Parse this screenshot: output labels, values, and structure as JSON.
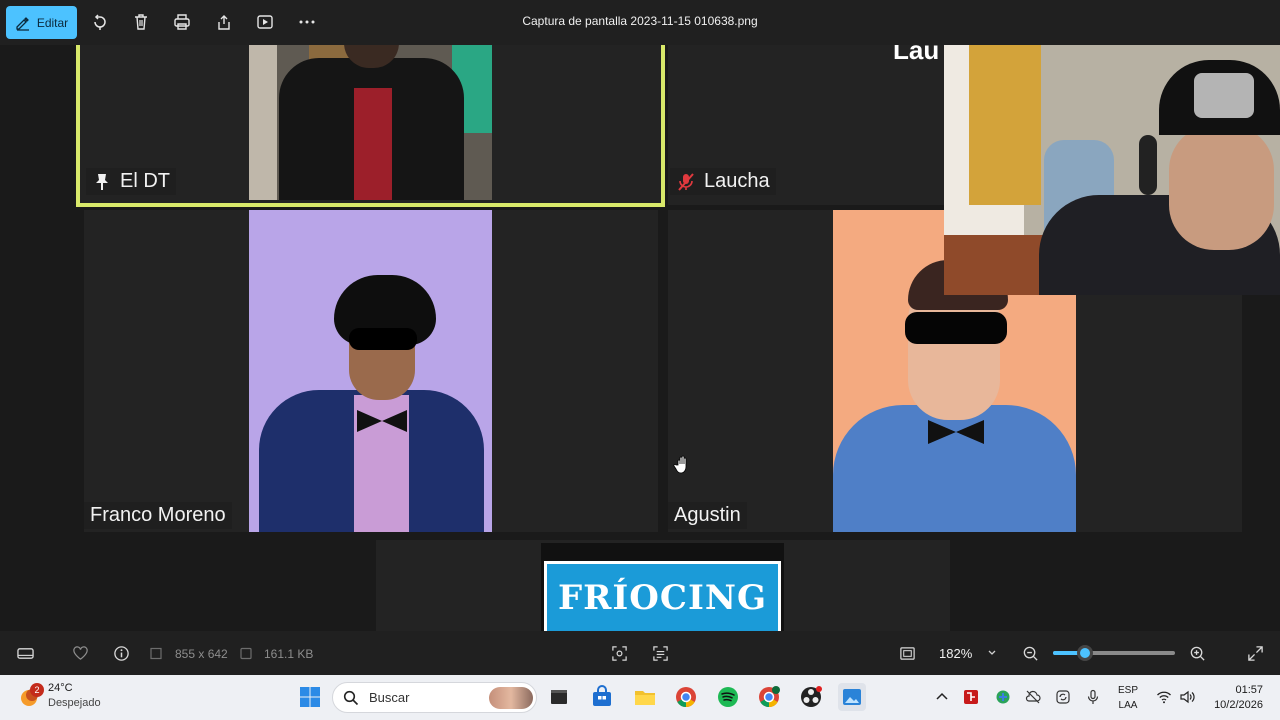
{
  "window": {
    "title": "Captura de pantalla 2023-11-15 010638.png",
    "edit_label": "Editar"
  },
  "toolbar_icons": [
    "rotate-icon",
    "delete-icon",
    "print-icon",
    "share-icon",
    "slideshow-icon",
    "more-icon"
  ],
  "meeting": {
    "participants": [
      {
        "name": "El DT",
        "status": "pinned"
      },
      {
        "name": "Laucha",
        "status": "muted"
      },
      {
        "name": "Franco Moreno",
        "status": ""
      },
      {
        "name": "Agustin",
        "status": ""
      }
    ],
    "share_banner_text": "FRÍOCING",
    "partial_text": "Lau"
  },
  "footer": {
    "dimensions": "855 x 642",
    "file_size": "161.1 KB",
    "zoom": "182%",
    "zoom_slider_fraction": 0.26
  },
  "taskbar": {
    "weather_temp": "24°C",
    "weather_desc": "Despejado",
    "weather_badge": "2",
    "search_placeholder": "Buscar",
    "lang_line1": "ESP",
    "lang_line2": "LAA",
    "time": "01:57",
    "date": "10/2/2026"
  },
  "colors": {
    "accent": "#4cc2ff",
    "active_speaker": "#d9e96a",
    "muted": "#e0393e"
  }
}
